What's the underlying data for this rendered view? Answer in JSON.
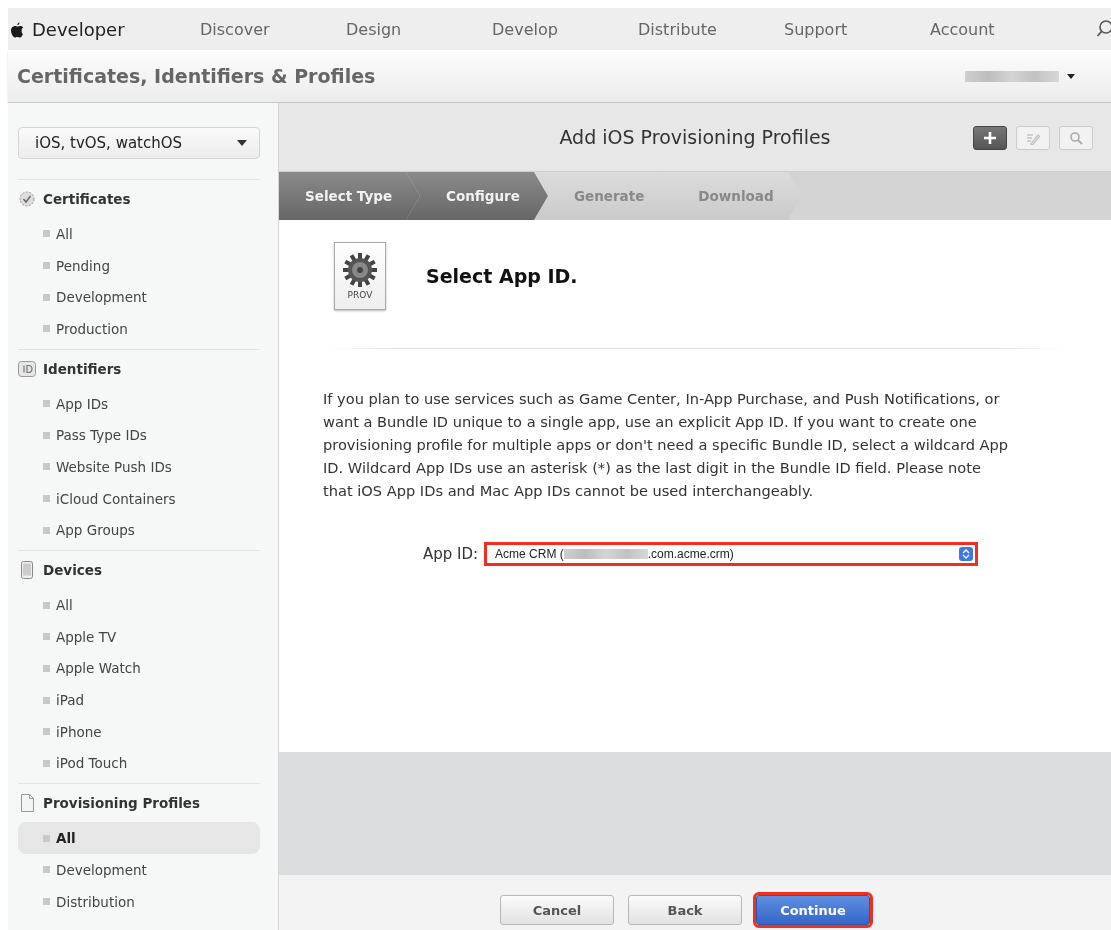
{
  "nav": {
    "brand": "Developer",
    "items": [
      "Discover",
      "Design",
      "Develop",
      "Distribute",
      "Support",
      "Account"
    ]
  },
  "header": {
    "title": "Certificates, Identifiers & Profiles",
    "account_redacted": true
  },
  "sidebar": {
    "platform": "iOS, tvOS, watchOS",
    "sections": [
      {
        "title": "Certificates",
        "kind": "badge",
        "items": [
          {
            "label": "All",
            "selected": false
          },
          {
            "label": "Pending",
            "selected": false
          },
          {
            "label": "Development",
            "selected": false
          },
          {
            "label": "Production",
            "selected": false
          }
        ]
      },
      {
        "title": "Identifiers",
        "kind": "id",
        "items": [
          {
            "label": "App IDs",
            "selected": false
          },
          {
            "label": "Pass Type IDs",
            "selected": false
          },
          {
            "label": "Website Push IDs",
            "selected": false
          },
          {
            "label": "iCloud Containers",
            "selected": false
          },
          {
            "label": "App Groups",
            "selected": false
          }
        ]
      },
      {
        "title": "Devices",
        "kind": "device",
        "items": [
          {
            "label": "All",
            "selected": false
          },
          {
            "label": "Apple TV",
            "selected": false
          },
          {
            "label": "Apple Watch",
            "selected": false
          },
          {
            "label": "iPad",
            "selected": false
          },
          {
            "label": "iPhone",
            "selected": false
          },
          {
            "label": "iPod Touch",
            "selected": false
          }
        ]
      },
      {
        "title": "Provisioning Profiles",
        "kind": "document",
        "items": [
          {
            "label": "All",
            "selected": true
          },
          {
            "label": "Development",
            "selected": false
          },
          {
            "label": "Distribution",
            "selected": false
          }
        ]
      }
    ]
  },
  "content": {
    "title": "Add iOS Provisioning Profiles",
    "toolbar": [
      {
        "kind": "add",
        "active": true
      },
      {
        "kind": "edit",
        "active": false
      },
      {
        "kind": "search",
        "active": false
      }
    ],
    "steps": [
      {
        "label": "Select Type",
        "completed": true
      },
      {
        "label": "Configure",
        "completed": true
      },
      {
        "label": "Generate",
        "completed": false
      },
      {
        "label": "Download",
        "completed": false
      }
    ],
    "file_icon_label": "PROV",
    "heading": "Select App ID.",
    "description": "If you plan to use services such as Game Center, In-App Purchase, and Push Notifications, or want a Bundle ID unique to a single app, use an explicit App ID. If you want to create one provisioning profile for multiple apps or don't need a specific Bundle ID, select a wildcard App ID. Wildcard App IDs use an asterisk (*) as the last digit in the Bundle ID field. Please note that iOS App IDs and Mac App IDs cannot be used interchangeably.",
    "app_id": {
      "label": "App ID:",
      "value_start": "Acme CRM (",
      "value_end": ".com.acme.crm)",
      "redacted": true,
      "highlighted": true
    },
    "buttons": [
      {
        "label": "Cancel",
        "kind": "secondary",
        "highlighted": false
      },
      {
        "label": "Back",
        "kind": "secondary",
        "highlighted": false
      },
      {
        "label": "Continue",
        "kind": "primary",
        "highlighted": true
      }
    ]
  }
}
